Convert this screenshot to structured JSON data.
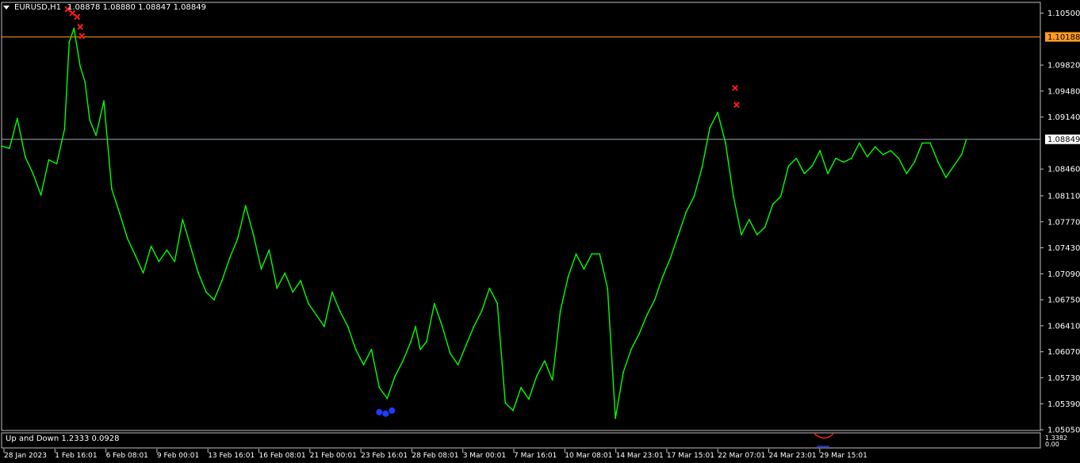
{
  "header": {
    "symbol": "EURUSD,H1",
    "ohlc": "1.08878 1.08880 1.08847 1.08849"
  },
  "indicator": {
    "label": "Up and Down 1.2333 0.0928",
    "side_value": "1.3382",
    "side_value2": "0.00"
  },
  "chart_data": {
    "type": "line",
    "title": "",
    "xlabel": "",
    "ylabel": "",
    "ylim": [
      1.0504,
      1.1064
    ],
    "x_tick_labels": [
      "28 Jan 2023",
      "1 Feb 16:01",
      "6 Feb 08:01",
      "9 Feb 00:01",
      "13 Feb 16:01",
      "16 Feb 08:01",
      "21 Feb 00:01",
      "23 Feb 16:01",
      "28 Feb 08:01",
      "3 Mar 00:01",
      "7 Mar 16:01",
      "10 Mar 08:01",
      "14 Mar 23:01",
      "17 Mar 15:01",
      "22 Mar 07:01",
      "24 Mar 23:01",
      "29 Mar 15:01"
    ],
    "y_tick_labels": [
      "1.10500",
      "1.09820",
      "1.09480",
      "1.09140",
      "1.08460",
      "1.08110",
      "1.07770",
      "1.07430",
      "1.07090",
      "1.06750",
      "1.06410",
      "1.06070",
      "1.05730",
      "1.05390",
      "1.05050"
    ],
    "y_tick_values": [
      1.105,
      1.0982,
      1.0948,
      1.0914,
      1.0846,
      1.0811,
      1.0777,
      1.0743,
      1.0709,
      1.0675,
      1.0641,
      1.0607,
      1.0573,
      1.0539,
      1.0505
    ],
    "horizontal_lines": [
      {
        "price": 1.10188,
        "label": "1.10188",
        "color": "#ff9b21"
      },
      {
        "price": 1.08849,
        "label": "1.08849",
        "color": "#9aa7b5"
      }
    ],
    "series": [
      {
        "color": "#00ff00",
        "x": [
          0,
          0.5,
          1.0,
          1.5,
          2.0,
          2.5,
          3.0,
          3.5,
          4.0,
          4.3,
          4.6,
          5.0,
          5.3,
          5.6,
          6.0,
          6.5,
          7.0,
          7.5,
          8.0,
          8.5,
          9.0,
          9.5,
          10.0,
          10.5,
          11.0,
          11.5,
          12.0,
          12.5,
          13.0,
          13.5,
          14.0,
          14.5,
          15.0,
          15.5,
          16.0,
          16.5,
          17.0,
          17.5,
          18.0,
          18.5,
          19.0,
          19.5,
          20.0,
          20.5,
          21.0,
          21.5,
          22.0,
          22.5,
          23.0,
          23.5,
          24.0,
          24.5,
          25.0,
          25.5,
          26.0,
          26.3,
          26.6,
          27.0,
          27.5,
          28.0,
          28.5,
          29.0,
          29.5,
          30.0,
          30.5,
          31.0,
          31.5,
          32.0,
          32.5,
          33.0,
          33.5,
          34.0,
          34.5,
          35.0,
          35.5,
          36.0,
          36.5,
          37.0,
          37.5,
          38.0,
          38.5,
          39.0,
          39.5,
          40.0,
          40.5,
          41.0,
          41.5,
          42.0,
          42.5,
          43.0,
          43.5,
          44.0,
          44.5,
          45.0,
          45.5,
          46.0,
          46.5,
          47.0,
          47.5,
          48.0,
          48.5,
          49.0,
          49.5,
          50.0,
          50.5,
          51.0,
          51.5,
          52.0,
          52.5,
          53.0,
          53.5,
          54.0,
          54.5,
          55.0,
          55.5,
          56.0,
          56.5,
          57.0,
          57.5,
          58.0,
          58.5,
          59.0,
          59.5,
          60.0,
          60.5,
          61.0,
          61.3
        ],
        "y": [
          1.0876,
          1.0873,
          1.0912,
          1.0862,
          1.084,
          1.0812,
          1.0858,
          1.0853,
          1.0898,
          1.1012,
          1.103,
          1.098,
          1.096,
          1.091,
          1.089,
          1.0935,
          1.082,
          1.0788,
          1.0755,
          1.0733,
          1.071,
          1.0745,
          1.0725,
          1.074,
          1.0725,
          1.078,
          1.0745,
          1.071,
          1.0685,
          1.0675,
          1.07,
          1.073,
          1.0755,
          1.0798,
          1.076,
          1.0715,
          1.074,
          1.069,
          1.071,
          1.0685,
          1.07,
          1.067,
          1.0655,
          1.064,
          1.0685,
          1.066,
          1.064,
          1.061,
          1.059,
          1.061,
          1.056,
          1.0546,
          1.0575,
          1.0595,
          1.062,
          1.064,
          1.061,
          1.062,
          1.067,
          1.064,
          1.0605,
          1.059,
          1.0615,
          1.064,
          1.066,
          1.069,
          1.067,
          1.054,
          1.053,
          1.056,
          1.0545,
          1.0575,
          1.0595,
          1.057,
          1.066,
          1.0705,
          1.0735,
          1.0715,
          1.0735,
          1.0735,
          1.069,
          1.052,
          1.058,
          1.061,
          1.063,
          1.0655,
          1.0675,
          1.0705,
          1.073,
          1.076,
          1.079,
          1.081,
          1.0848,
          1.09,
          1.092,
          1.088,
          1.081,
          1.076,
          1.078,
          1.076,
          1.077,
          1.08,
          1.081,
          1.085,
          1.086,
          1.084,
          1.085,
          1.087,
          1.084,
          1.086,
          1.0855,
          1.086,
          1.088,
          1.0862,
          1.0875,
          1.0865,
          1.087,
          1.086,
          1.084,
          1.0855,
          1.088,
          1.088,
          1.0855,
          1.0835,
          1.085,
          1.0865,
          1.0885
        ]
      }
    ],
    "sell_signals": [
      {
        "x": 4.2,
        "y": 1.1055
      },
      {
        "x": 4.5,
        "y": 1.105
      },
      {
        "x": 4.8,
        "y": 1.1045
      },
      {
        "x": 5.0,
        "y": 1.1032
      },
      {
        "x": 5.1,
        "y": 1.102
      },
      {
        "x": 46.6,
        "y": 1.0952
      },
      {
        "x": 46.7,
        "y": 1.093
      }
    ],
    "buy_signals": [
      {
        "x": 24.0,
        "y": 1.0528
      },
      {
        "x": 24.4,
        "y": 1.0526
      },
      {
        "x": 24.8,
        "y": 1.053
      }
    ]
  }
}
